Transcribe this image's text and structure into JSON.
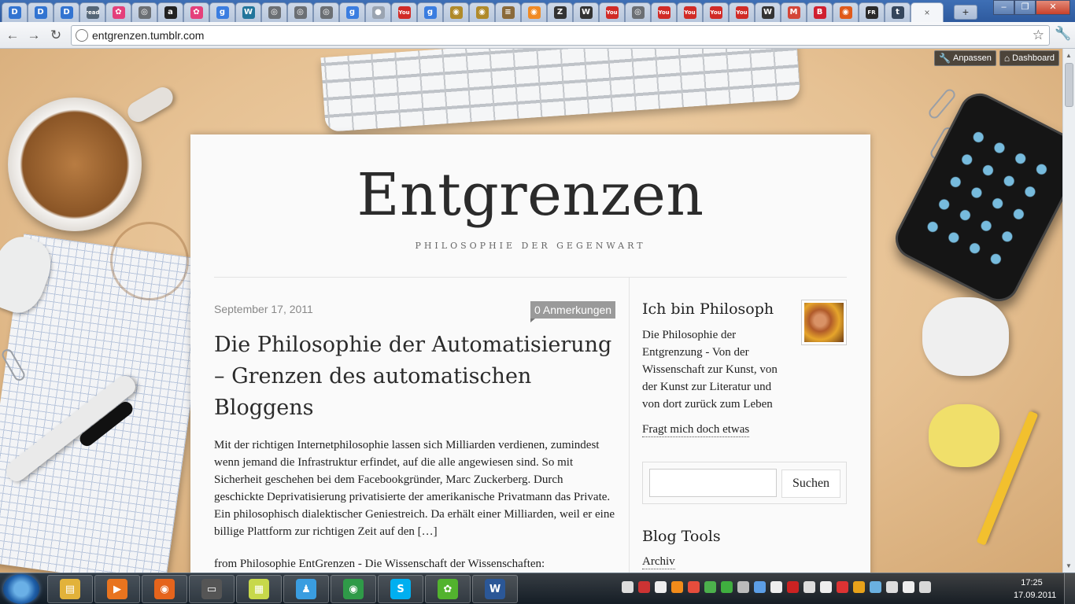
{
  "browser": {
    "tabs": [
      {
        "icon": "delicious-icon",
        "glyph": "D",
        "color": "#3274d1"
      },
      {
        "icon": "delicious-icon",
        "glyph": "D",
        "color": "#3274d1"
      },
      {
        "icon": "delicious-icon",
        "glyph": "D",
        "color": "#3274d1"
      },
      {
        "icon": "read-icon",
        "glyph": "read",
        "color": "#556677"
      },
      {
        "icon": "flickr-icon",
        "glyph": "✿",
        "color": "#e4407b"
      },
      {
        "icon": "globe-icon",
        "glyph": "◎",
        "color": "#6b6f74"
      },
      {
        "icon": "amazon-icon",
        "glyph": "a",
        "color": "#222222"
      },
      {
        "icon": "flickr-icon",
        "glyph": "✿",
        "color": "#e4407b"
      },
      {
        "icon": "google-icon",
        "glyph": "g",
        "color": "#3a7de0"
      },
      {
        "icon": "wordpress-icon",
        "glyph": "W",
        "color": "#21759b"
      },
      {
        "icon": "globe-icon",
        "glyph": "◎",
        "color": "#6b6f74"
      },
      {
        "icon": "globe-icon",
        "glyph": "◎",
        "color": "#6b6f74"
      },
      {
        "icon": "globe-icon",
        "glyph": "◎",
        "color": "#6b6f74"
      },
      {
        "icon": "google-icon",
        "glyph": "g",
        "color": "#3a7de0"
      },
      {
        "icon": "blank-icon",
        "glyph": "●",
        "color": "#9aa4b1"
      },
      {
        "icon": "youtube-icon",
        "glyph": "You",
        "color": "#d12b26"
      },
      {
        "icon": "google-icon",
        "glyph": "g",
        "color": "#3a7de0"
      },
      {
        "icon": "owl-icon",
        "glyph": "◉",
        "color": "#b08a2a"
      },
      {
        "icon": "owl-icon",
        "glyph": "◉",
        "color": "#b08a2a"
      },
      {
        "icon": "news-icon",
        "glyph": "≡",
        "color": "#8a6a3a"
      },
      {
        "icon": "orange-icon",
        "glyph": "◉",
        "color": "#f08a24"
      },
      {
        "icon": "z-icon",
        "glyph": "Z",
        "color": "#333333"
      },
      {
        "icon": "wikipedia-icon",
        "glyph": "W",
        "color": "#333333"
      },
      {
        "icon": "youtube-icon",
        "glyph": "You",
        "color": "#d12b26"
      },
      {
        "icon": "globe-icon",
        "glyph": "◎",
        "color": "#6b6f74"
      },
      {
        "icon": "youtube-icon",
        "glyph": "You",
        "color": "#d12b26"
      },
      {
        "icon": "youtube-icon",
        "glyph": "You",
        "color": "#d12b26"
      },
      {
        "icon": "youtube-icon",
        "glyph": "You",
        "color": "#d12b26"
      },
      {
        "icon": "youtube-icon",
        "glyph": "You",
        "color": "#d12b26"
      },
      {
        "icon": "wikipedia-icon",
        "glyph": "W",
        "color": "#333333"
      },
      {
        "icon": "gmail-icon",
        "glyph": "M",
        "color": "#d44638"
      },
      {
        "icon": "blogger-b-icon",
        "glyph": "B",
        "color": "#d01f2f"
      },
      {
        "icon": "orange-circle-icon",
        "glyph": "◉",
        "color": "#e05a1a"
      },
      {
        "icon": "fr-icon",
        "glyph": "FR",
        "color": "#2a2a2a"
      },
      {
        "icon": "tumblr-icon",
        "glyph": "t",
        "color": "#35465c"
      }
    ],
    "active_tab": {
      "icon": "close-icon",
      "glyph": "×"
    },
    "new_tab": "+",
    "url": "entgrenzen.tumblr.com"
  },
  "tumblr": {
    "customize": "Anpassen",
    "dashboard": "Dashboard"
  },
  "blog": {
    "title": "Entgrenzen",
    "subtitle": "PHILOSOPHIE DER GEGENWART"
  },
  "post": {
    "date": "September 17, 2011",
    "notes": "0 Anmerkungen",
    "title": "Die Philosophie der Automatisierung – Grenzen des automatischen Bloggens",
    "body": "Mit der richtigen Internetphilosophie lassen sich Milliarden verdienen, zumindest wenn jemand die Infrastruktur erfindet, auf die alle angewiesen sind. So mit Sicherheit geschehen bei dem Facebookgründer, Marc Zuckerberg. Durch geschickte Deprivatisierung privatisierte der amerikanische Privatmann das Private. Ein philosophisch dialektischer Geniestreich. Da erhält einer Milliarden, weil er eine billige Plattform zur richtigen Zeit auf den […]",
    "source": "from Philosophie EntGrenzen - Die Wissenschaft der Wissenschaften:"
  },
  "sidebar": {
    "heading": "Ich bin Philosoph",
    "description": "Die Philosophie der Entgrenzung - Von der Wissenschaft zur Kunst, von der Kunst zur Literatur und von dort zurück zum Leben",
    "ask": "Fragt mich doch etwas",
    "search_button": "Suchen",
    "tools_heading": "Blog Tools",
    "archive": "Archiv"
  },
  "taskbar": {
    "apps": [
      {
        "icon": "explorer-icon",
        "glyph": "▤",
        "color": "#e2b23a"
      },
      {
        "icon": "media-player-icon",
        "glyph": "▶",
        "color": "#e8741f"
      },
      {
        "icon": "firefox-icon",
        "glyph": "◉",
        "color": "#e5641c"
      },
      {
        "icon": "tv-icon",
        "glyph": "▭",
        "color": "#555555"
      },
      {
        "icon": "sticky-notes-icon",
        "glyph": "▦",
        "color": "#c7d84a"
      },
      {
        "icon": "messenger-icon",
        "glyph": "♟",
        "color": "#3a9de0"
      },
      {
        "icon": "chrome-icon",
        "glyph": "◉",
        "color": "#2f9a48"
      },
      {
        "icon": "skype-icon",
        "glyph": "S",
        "color": "#00aff0"
      },
      {
        "icon": "icq-icon",
        "glyph": "✿",
        "color": "#52b32e"
      },
      {
        "icon": "word-icon",
        "glyph": "W",
        "color": "#2b5797"
      }
    ],
    "tray_colors": [
      "#dddddd",
      "#c33",
      "#eeeeee",
      "#f28c1a",
      "#e64d3c",
      "#4cb04c",
      "#3fae3f",
      "#bbbbbb",
      "#5c9ee6",
      "#eeeeee",
      "#cc2222",
      "#dddddd",
      "#eeeeee",
      "#d33",
      "#e8a21a",
      "#6ab0e0",
      "#dddddd",
      "#eeeeee",
      "#d8d8d8"
    ],
    "time": "17:25",
    "date": "17.09.2011"
  }
}
